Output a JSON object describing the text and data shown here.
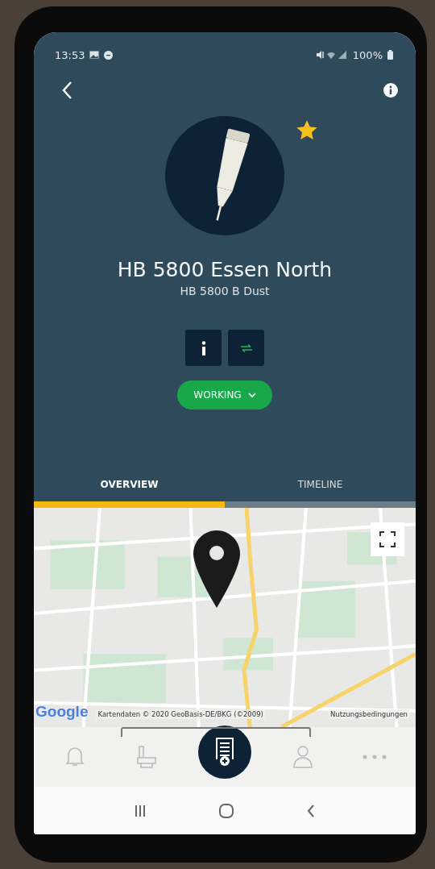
{
  "status_bar": {
    "time": "13:53",
    "battery": "100%"
  },
  "device": {
    "name": "HB 5800 Essen North",
    "model": "HB 5800 B Dust",
    "favorite": true
  },
  "status": {
    "label": "WORKING"
  },
  "tabs": [
    {
      "label": "OVERVIEW",
      "selected": true
    },
    {
      "label": "TIMELINE",
      "selected": false
    }
  ],
  "map": {
    "logo": "Google",
    "attribution": "Kartendaten © 2020 GeoBasis-DE/BKG (©2009)",
    "terms": "Nutzungsbedingungen"
  },
  "bottom_nav": [
    {
      "kind": "bell",
      "selected": false
    },
    {
      "kind": "machine",
      "selected": false
    },
    {
      "kind": "report",
      "selected": true
    },
    {
      "kind": "person",
      "selected": false
    },
    {
      "kind": "more",
      "selected": false
    }
  ]
}
